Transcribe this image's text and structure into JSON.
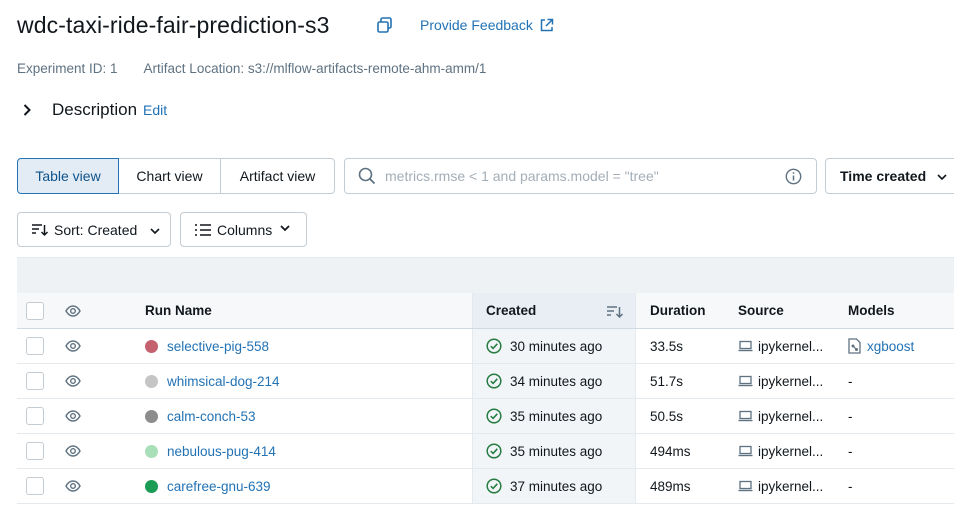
{
  "header": {
    "title": "wdc-taxi-ride-fair-prediction-s3",
    "feedback_label": "Provide Feedback"
  },
  "meta": {
    "experiment_id": "Experiment ID: 1",
    "artifact_location": "Artifact Location: s3://mlflow-artifacts-remote-ahm-amm/1"
  },
  "description": {
    "label": "Description",
    "edit_label": "Edit"
  },
  "view_tabs": [
    {
      "label": "Table view",
      "active": true
    },
    {
      "label": "Chart view",
      "active": false
    },
    {
      "label": "Artifact view",
      "active": false
    }
  ],
  "search": {
    "placeholder": "metrics.rmse < 1 and params.model = \"tree\"",
    "value": ""
  },
  "time_select": {
    "label": "Time created"
  },
  "controls": {
    "sort_label": "Sort: Created",
    "columns_label": "Columns"
  },
  "table": {
    "headers": {
      "run_name": "Run Name",
      "created": "Created",
      "duration": "Duration",
      "source": "Source",
      "models": "Models"
    },
    "rows": [
      {
        "name": "selective-pig-558",
        "color": "#c5606f",
        "created": "30 minutes ago",
        "duration": "33.5s",
        "source": "ipykernel...",
        "model": "xgboost"
      },
      {
        "name": "whimsical-dog-214",
        "color": "#c5c5c5",
        "created": "34 minutes ago",
        "duration": "51.7s",
        "source": "ipykernel...",
        "model": "-"
      },
      {
        "name": "calm-conch-53",
        "color": "#8c8c8c",
        "created": "35 minutes ago",
        "duration": "50.5s",
        "source": "ipykernel...",
        "model": "-"
      },
      {
        "name": "nebulous-pug-414",
        "color": "#a9dfb8",
        "created": "35 minutes ago",
        "duration": "494ms",
        "source": "ipykernel...",
        "model": "-"
      },
      {
        "name": "carefree-gnu-639",
        "color": "#1a9c54",
        "created": "37 minutes ago",
        "duration": "489ms",
        "source": "ipykernel...",
        "model": "-"
      }
    ]
  },
  "colors": {
    "link": "#2272b4",
    "success": "#277c43",
    "border": "#c4ccd2",
    "active_tab_bg": "#e3ebf4"
  }
}
